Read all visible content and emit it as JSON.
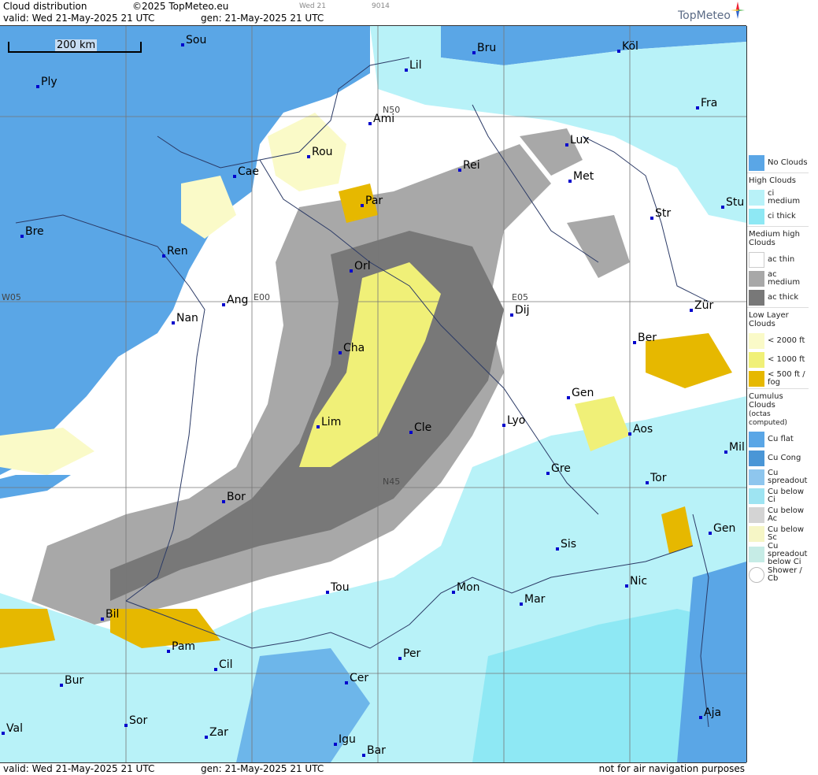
{
  "header": {
    "product": "Cloud distribution",
    "copyright": "©2025 TopMeteo.eu",
    "valid": "valid:  Wed  21-May-2025  21 UTC",
    "generated": "gen: 21-May-2025 21 UTC",
    "small_day": "Wed 21",
    "small_code": "9014",
    "brand": "TopMeteo"
  },
  "footer": {
    "valid": "valid:  Wed  21-May-2025  21 UTC",
    "generated": "gen: 21-May-2025 21 UTC",
    "disclaimer": "not for air navigation purposes"
  },
  "map": {
    "scale": "200 km",
    "coords": [
      "N50",
      "N45",
      "W05",
      "E00",
      "E05"
    ],
    "cities": [
      "Sou",
      "Bru",
      "Köl",
      "Ply",
      "Lil",
      "Ami",
      "Fra",
      "Lux",
      "Rou",
      "Cae",
      "Rei",
      "Met",
      "Par",
      "Stu",
      "Str",
      "Bre",
      "Ren",
      "Orl",
      "Ang",
      "Dij",
      "Zür",
      "Nan",
      "Ber",
      "Cha",
      "Gen",
      "Lim",
      "Cle",
      "Lyo",
      "Aos",
      "Mil",
      "Gre",
      "Tor",
      "Bor",
      "Gen",
      "Sis",
      "Nic",
      "Tou",
      "Mon",
      "Mar",
      "Bil",
      "Pam",
      "Cil",
      "Per",
      "Bur",
      "Cer",
      "Sor",
      "Zar",
      "Aja",
      "Val",
      "Igu",
      "Bar"
    ]
  },
  "legend": {
    "no_clouds": "No Clouds",
    "high": "High Clouds",
    "ci_medium": "ci medium",
    "ci_thick": "ci thick",
    "medium": "Medium high Clouds",
    "ac_thin": "ac thin",
    "ac_medium": "ac medium",
    "ac_thick": "ac thick",
    "low": "Low Layer Clouds",
    "low_2000": "< 2000 ft",
    "low_1000": "< 1000 ft",
    "low_500": "< 500 ft / fog",
    "cumulus": "Cumulus Clouds",
    "cumulus_note": "(octas computed)",
    "cu_flat": "Cu flat",
    "cu_cong": "Cu Cong",
    "cu_spread": "Cu spreadout",
    "cu_below_ci": "Cu below Ci",
    "cu_below_ac": "Cu below Ac",
    "cu_below_sc": "Cu below Sc",
    "cu_spread_ci": "Cu spreadout below Ci",
    "shower": "Shower / Cb"
  },
  "colors": {
    "no_clouds": "#5aa6e6",
    "ci_medium": "#b8f2f8",
    "ci_thick": "#8ee8f4",
    "ac_thin": "#ffffff",
    "ac_medium": "#a8a8a8",
    "ac_thick": "#787878",
    "low_2000": "#fafac8",
    "low_1000": "#f0f078",
    "low_500": "#e6b800"
  }
}
